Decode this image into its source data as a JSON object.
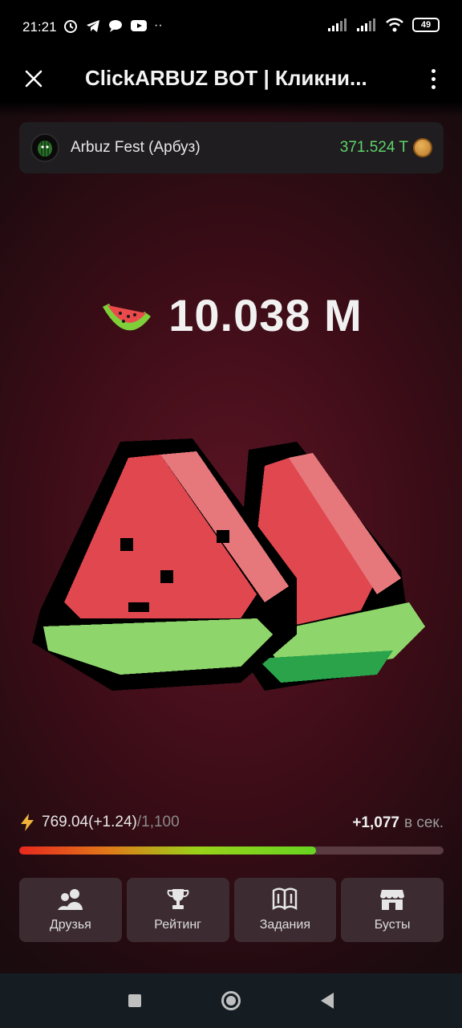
{
  "status_bar": {
    "time": "21:21",
    "battery": "49",
    "left_icons": [
      "alarm-icon",
      "telegram-icon",
      "chat-icon",
      "youtube-icon",
      "more-dots-icon"
    ],
    "right_icons": [
      "signal-icon",
      "signal-icon",
      "wifi-icon",
      "battery-icon"
    ]
  },
  "app_bar": {
    "title": "ClickARBUZ BOT | Кликни...",
    "close_icon": "close-icon",
    "menu_icon": "more-vertical-icon"
  },
  "league": {
    "name": "Arbuz Fest (Арбуз)",
    "score": "371.524 T",
    "score_color": "#5fd46a",
    "coin_icon": "coin-icon",
    "avatar_icon": "melon-avatar-icon"
  },
  "balance": {
    "icon": "watermelon-slice-icon",
    "value": "10.038 M"
  },
  "energy": {
    "icon": "lightning-icon",
    "current": "769.04(+1.24)",
    "max": "/1,100",
    "fill_fraction": 0.7,
    "income_value": "+1,077",
    "income_unit": "в сек."
  },
  "nav": [
    {
      "label": "Друзья",
      "icon": "friends-icon"
    },
    {
      "label": "Рейтинг",
      "icon": "trophy-icon"
    },
    {
      "label": "Задания",
      "icon": "tasks-book-icon"
    },
    {
      "label": "Бусты",
      "icon": "shop-icon"
    }
  ],
  "colors": {
    "background": "#3a0c16",
    "watermelon_red": "#e0474f",
    "watermelon_rind": "#8ed66b"
  }
}
